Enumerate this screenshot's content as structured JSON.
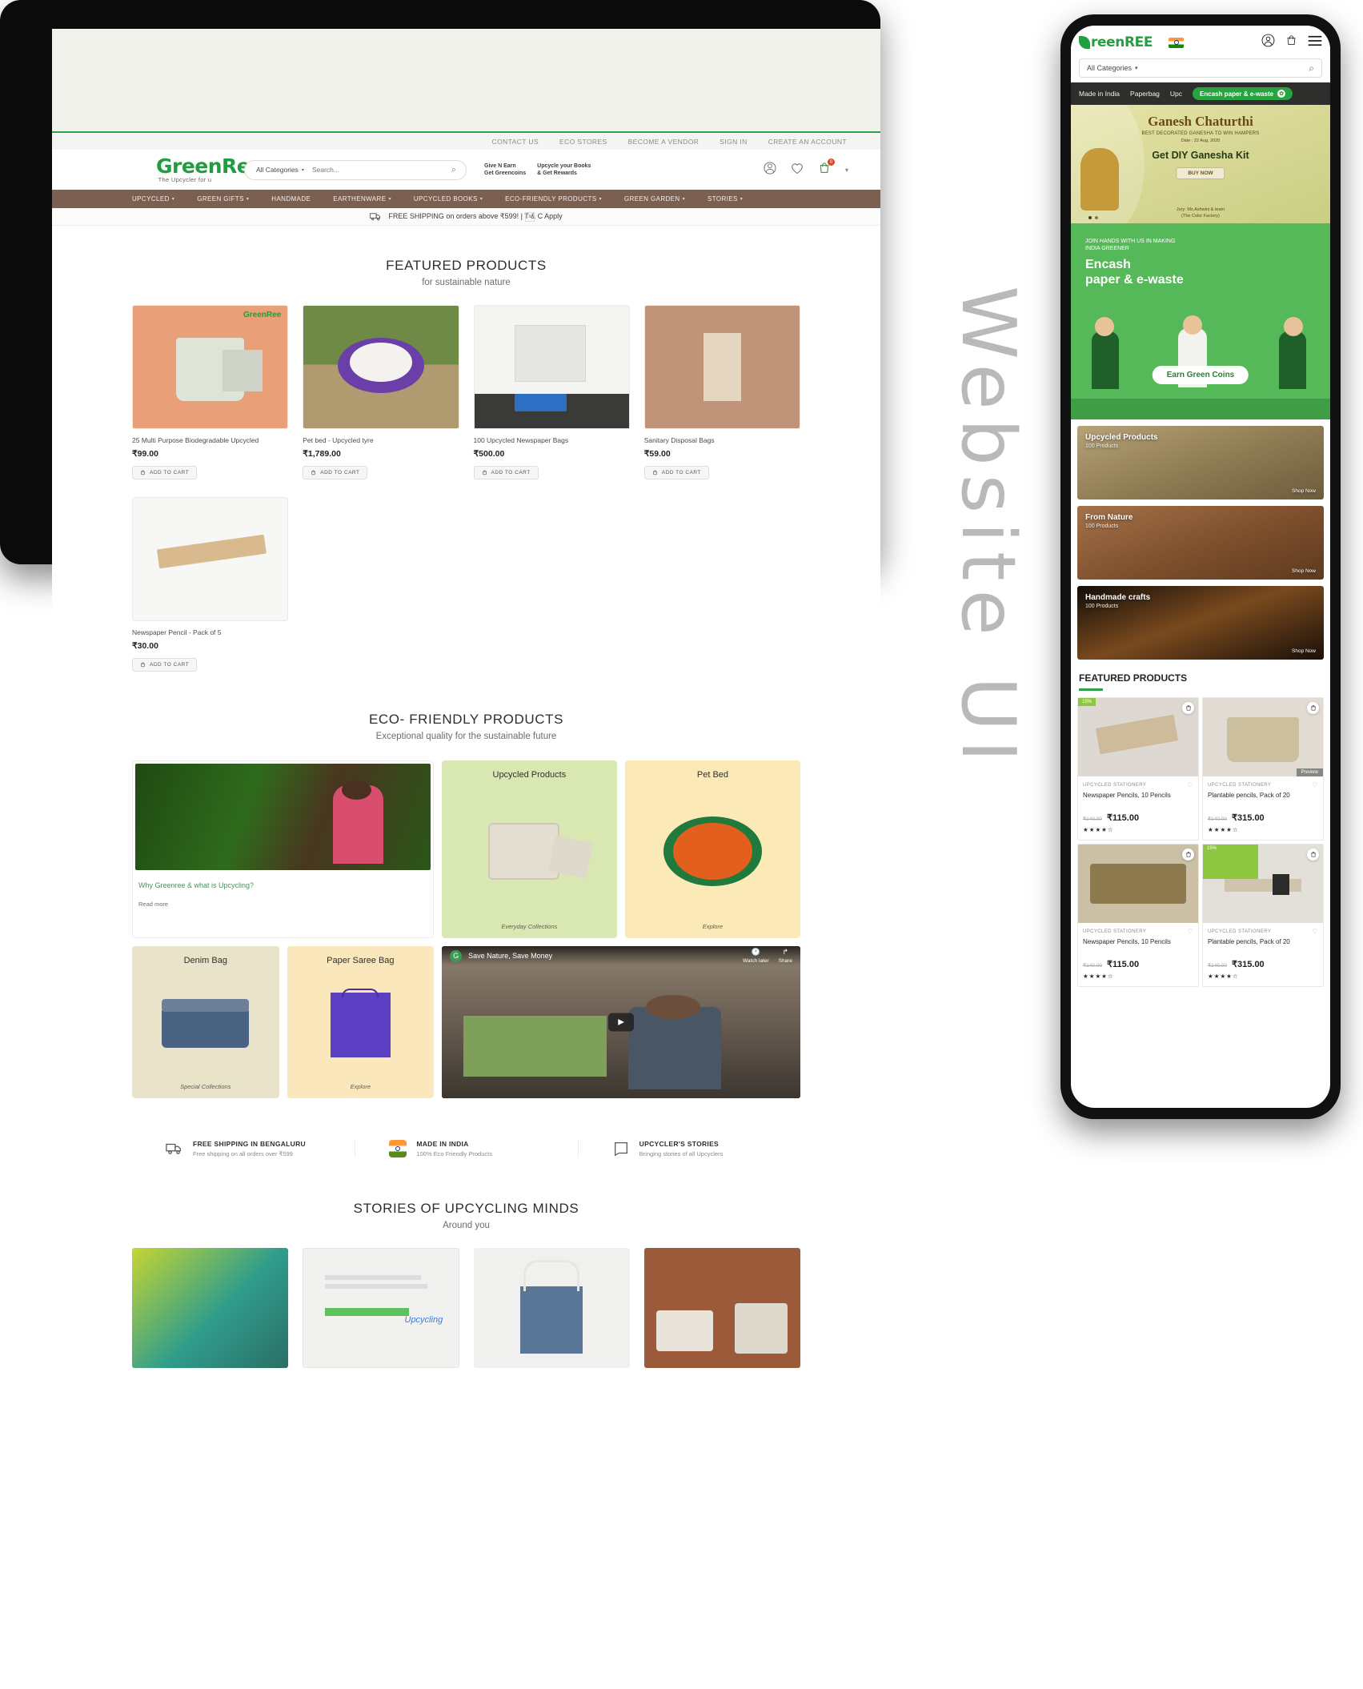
{
  "side_label": "Website UI",
  "desktop": {
    "util_links": [
      "CONTACT US",
      "ECO STORES",
      "BECOME A VENDOR",
      "SIGN IN",
      "CREATE AN ACCOUNT"
    ],
    "logo": {
      "name": "GreenRee",
      "tagline": "The Upcycler for u"
    },
    "search": {
      "category": "All Categories",
      "placeholder": "Search..."
    },
    "promos": [
      {
        "line1": "Give N Earn",
        "line2": "Get Greencoins"
      },
      {
        "line1": "Upcycle your Books",
        "line2": "& Get Rewards"
      }
    ],
    "cart_count": "0",
    "nav": [
      {
        "label": "UPCYCLED",
        "caret": true
      },
      {
        "label": "GREEN GIFTS",
        "caret": true
      },
      {
        "label": "HANDMADE",
        "caret": false
      },
      {
        "label": "EARTHENWARE",
        "caret": true
      },
      {
        "label": "UPCYCLED BOOKS",
        "caret": true
      },
      {
        "label": "ECO-FRIENDLY PRODUCTS",
        "caret": true
      },
      {
        "label": "GREEN GARDEN",
        "caret": true
      },
      {
        "label": "STORIES",
        "caret": true
      }
    ],
    "shipping_banner": {
      "text": "FREE SHIPPING on orders above ₹599! | T & C Apply",
      "close": "x"
    },
    "featured": {
      "title": "FEATURED PRODUCTS",
      "subtitle": "for sustainable nature",
      "add_to_cart": "ADD TO CART",
      "products": [
        {
          "name": "25 Multi Purpose Biodegradable Upcycled",
          "price": "₹99.00"
        },
        {
          "name": "Pet bed - Upcycled tyre",
          "price": "₹1,789.00"
        },
        {
          "name": "100 Upcycled Newspaper Bags",
          "price": "₹500.00"
        },
        {
          "name": "Sanitary Disposal Bags",
          "price": "₹59.00"
        },
        {
          "name": "Newspaper Pencil - Pack of 5",
          "price": "₹30.00"
        }
      ]
    },
    "eco": {
      "title": "ECO- FRIENDLY PRODUCTS",
      "subtitle": "Exceptional quality for the sustainable future",
      "story": {
        "title": "Why Greenree & what is Upcycling?",
        "link": "Read more"
      },
      "tiles": [
        {
          "title": "Upcycled Products",
          "caption": "Everyday Collections"
        },
        {
          "title": "Pet Bed",
          "caption": "Explore"
        },
        {
          "title": "Denim Bag",
          "caption": "Special Collections"
        },
        {
          "title": "Paper Saree Bag",
          "caption": "Explore"
        }
      ],
      "video": {
        "title": "Save Nature, Save Money",
        "watch_later": "Watch later",
        "share": "Share"
      }
    },
    "features": [
      {
        "title": "FREE SHIPPING IN BENGALURU",
        "sub": "Free shipping on all orders over ₹599",
        "icon": "truck-icon"
      },
      {
        "title": "MADE IN INDIA",
        "sub": "100% Eco Friendly Products",
        "icon": "flag-icon"
      },
      {
        "title": "UPCYCLER'S STORIES",
        "sub": "Bringing stories of all Upcyclers",
        "icon": "story-icon"
      }
    ],
    "stories": {
      "title": "STORIES OF UPCYCLING MINDS",
      "subtitle": "Around you"
    }
  },
  "mobile": {
    "logo": "reenREE",
    "search": {
      "category": "All Categories"
    },
    "chips": [
      "Made in India",
      "Paperbag",
      "Upc"
    ],
    "chip_green": "Encash paper & e-waste",
    "banner": {
      "title": "Ganesh Chaturthi",
      "line1": "BEST DECORATED GANESHA TO WIN HAMPERS",
      "line2": "Date : 22 Aug, 2020",
      "headline": "Get DIY Ganesha Kit",
      "button": "BUY NOW",
      "jury1": "Jury: Ms.Ashwini & team",
      "jury2": "(The Color Factory)"
    },
    "green_banner": {
      "line1": "JOIN HANDS WITH US IN MAKING",
      "line2": "INDIA GREENER",
      "title1": "Encash",
      "title2": "paper & e-waste",
      "button": "Earn Green Coins"
    },
    "categories": [
      {
        "title": "Upcycled Products",
        "count": "100 Products",
        "cta": "Shop Now"
      },
      {
        "title": "From Nature",
        "count": "100 Products",
        "cta": "Shop Now"
      },
      {
        "title": "Handmade crafts",
        "count": "100 Products",
        "cta": "Shop Now"
      }
    ],
    "featured_title": "FEATURED PRODUCTS",
    "products": [
      {
        "badge": "15%",
        "category": "UPCYCLED STATIONERY",
        "name": "Newspaper Pencils, 10 Pencils",
        "old_price": "₹140.00",
        "price": "₹115.00",
        "stars": "★★★★☆",
        "preview": ""
      },
      {
        "badge": "",
        "category": "UPCYCLED STATIONERY",
        "name": "Plantable pencils, Pack of 20",
        "old_price": "₹140.00",
        "price": "₹315.00",
        "stars": "★★★★☆",
        "preview": "Preview"
      },
      {
        "badge": "",
        "category": "UPCYCLED STATIONERY",
        "name": "Newspaper Pencils, 10 Pencils",
        "old_price": "₹140.00",
        "price": "₹115.00",
        "stars": "★★★★☆",
        "preview": ""
      },
      {
        "badge": "15%",
        "category": "UPCYCLED STATIONERY",
        "name": "Plantable pencils, Pack of 20",
        "old_price": "₹140.00",
        "price": "₹315.00",
        "stars": "★★★★☆",
        "preview": ""
      }
    ]
  },
  "colors": {
    "brand_green": "#1f9d3f",
    "nav_brown": "#7b6052",
    "accent_green": "#29a33f"
  }
}
